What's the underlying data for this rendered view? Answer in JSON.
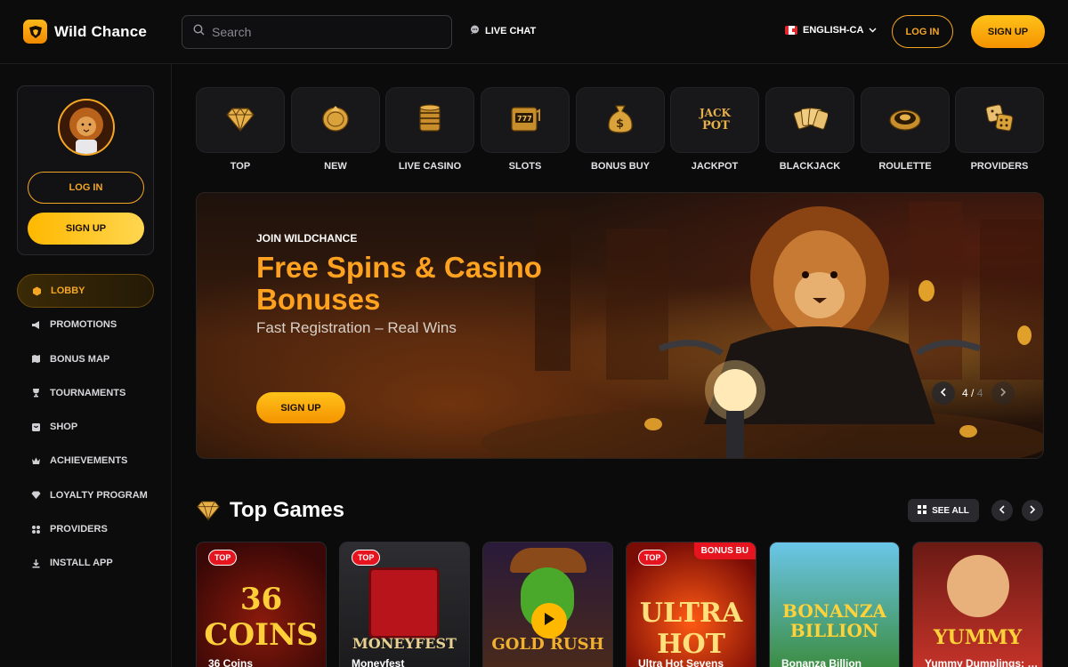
{
  "header": {
    "brand": "Wild Chance",
    "search_placeholder": "Search",
    "live_chat": "LIVE CHAT",
    "language": "ENGLISH-CA",
    "login": "LOG IN",
    "signup": "SIGN UP"
  },
  "sidebar": {
    "login": "LOG IN",
    "signup": "SIGN UP",
    "items": [
      {
        "label": "LOBBY",
        "icon": "cube-icon"
      },
      {
        "label": "PROMOTIONS",
        "icon": "megaphone-icon"
      },
      {
        "label": "BONUS MAP",
        "icon": "map-icon"
      },
      {
        "label": "TOURNAMENTS",
        "icon": "trophy-icon"
      },
      {
        "label": "SHOP",
        "icon": "shop-icon"
      },
      {
        "label": "ACHIEVEMENTS",
        "icon": "crown-icon"
      },
      {
        "label": "LOYALTY PROGRAM",
        "icon": "diamond-icon"
      },
      {
        "label": "PROVIDERS",
        "icon": "grid-icon"
      },
      {
        "label": "INSTALL APP",
        "icon": "download-icon"
      }
    ]
  },
  "categories": [
    {
      "label": "TOP",
      "icon": "diamond-icon"
    },
    {
      "label": "NEW",
      "icon": "coin-icon"
    },
    {
      "label": "LIVE CASINO",
      "icon": "chips-icon"
    },
    {
      "label": "SLOTS",
      "icon": "slot-machine-icon"
    },
    {
      "label": "BONUS BUY",
      "icon": "money-bag-icon"
    },
    {
      "label": "JACKPOT",
      "icon": "jackpot-icon"
    },
    {
      "label": "BLACKJACK",
      "icon": "cards-icon"
    },
    {
      "label": "ROULETTE",
      "icon": "roulette-icon"
    },
    {
      "label": "PROVIDERS",
      "icon": "dice-icon"
    }
  ],
  "banner": {
    "kicker": "JOIN WILDCHANCE",
    "title": "Free Spins & Casino Bonuses",
    "subtitle": "Fast Registration – Real Wins",
    "cta": "SIGN UP",
    "current": "4",
    "separator": "/",
    "total": "4"
  },
  "top_games": {
    "title": "Top Games",
    "see_all": "SEE ALL",
    "games": [
      {
        "title": "36 Coins",
        "badge": "TOP",
        "art": "36 COINS"
      },
      {
        "title": "Moneyfest",
        "badge": "TOP",
        "art": "MONEYFEST"
      },
      {
        "title": "Gold Rush",
        "badge": "",
        "art": "GOLD RUSH"
      },
      {
        "title": "Ultra Hot Sevens",
        "badge": "TOP",
        "corner_badge": "BONUS BU",
        "art": "ULTRA HOT"
      },
      {
        "title": "Bonanza Billion",
        "badge": "",
        "art": "BONANZA BILLION"
      },
      {
        "title": "Yummy Dumplings: Hold and Win",
        "badge": "",
        "art": "YUMMY"
      }
    ]
  },
  "colors": {
    "accent": "#f5a623",
    "accent_bright": "#ffc21a",
    "badge_red": "#e5141f",
    "background": "#0b0b0c"
  }
}
